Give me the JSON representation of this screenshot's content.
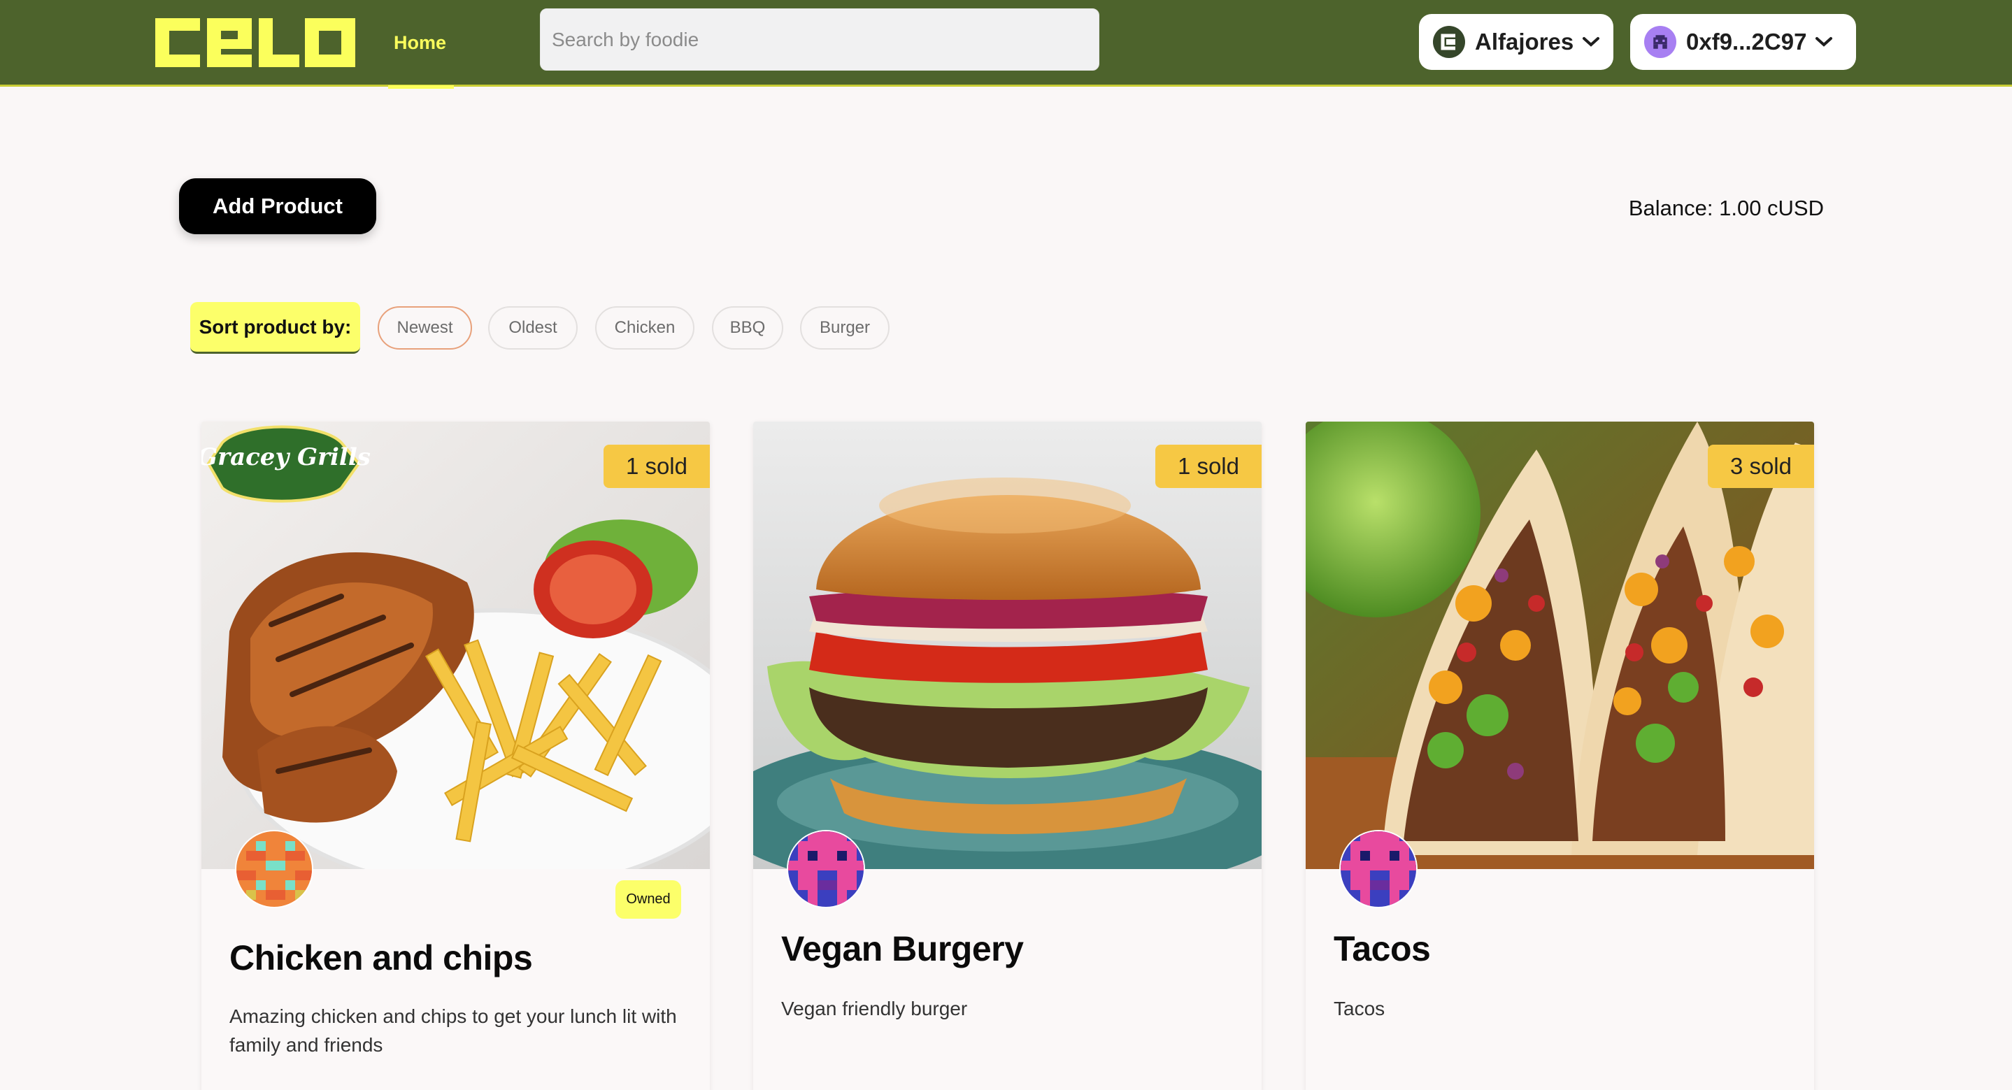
{
  "header": {
    "logo_text": "celo",
    "nav_home": "Home",
    "search_placeholder": "Search by foodie",
    "network_label": "Alfajores",
    "account_label": "0xf9...2C97"
  },
  "toolbar": {
    "add_product_label": "Add Product",
    "balance_text": "Balance: 1.00 cUSD"
  },
  "sort": {
    "label": "Sort product by:",
    "options": [
      "Newest",
      "Oldest",
      "Chicken",
      "BBQ",
      "Burger"
    ],
    "active": "Newest"
  },
  "products": [
    {
      "title": "Chicken and chips",
      "description": "Amazing chicken and chips to get your lunch lit with family and friends",
      "sold": "1 sold",
      "owned_label": "Owned",
      "image_logo_text": "Gracey Grills"
    },
    {
      "title": "Vegan Burgery",
      "description": "Vegan friendly burger",
      "sold": "1 sold"
    },
    {
      "title": "Tacos",
      "description": "Tacos",
      "sold": "3 sold"
    }
  ],
  "colors": {
    "header_bg": "#4d632c",
    "accent_yellow": "#fbff5c",
    "sold_badge": "#f6c844"
  }
}
